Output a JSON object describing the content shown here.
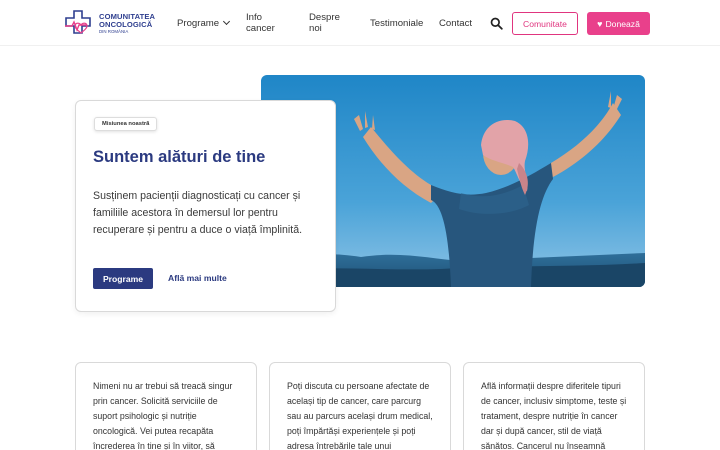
{
  "header": {
    "logo": {
      "line1": "COMUNITATEA",
      "line2": "ONCOLOGICĂ",
      "line3": "DIN ROMÂNIA"
    },
    "nav": [
      {
        "label": "Programe",
        "has_dropdown": true
      },
      {
        "label": "Info cancer"
      },
      {
        "label": "Despre noi"
      },
      {
        "label": "Testimoniale"
      },
      {
        "label": "Contact"
      }
    ],
    "search_icon": "search-icon",
    "community_button": "Comunitate",
    "donate_button": "Donează",
    "donate_icon": "heart-icon"
  },
  "hero": {
    "badge": "Misiunea noastră",
    "title": "Suntem alături de tine",
    "description": "Susținem pacienții diagnosticați cu cancer și familiile acestora în demersul lor pentru recuperare și pentru a duce o viață împlinită.",
    "primary_button": "Programe",
    "secondary_link": "Află mai multe"
  },
  "cards": [
    {
      "text": "Nimeni nu ar trebui să treacă singur prin cancer. Solicită serviciile de suport psihologic și nutriție oncologică. Vei putea recapăta încrederea în tine și în viitor, să"
    },
    {
      "text": "Poți discuta cu persoane afectate de același tip de cancer, care parcurg sau au parcurs același drum medical, poți împărtăși experiențele și poți adresa întrebările tale unui"
    },
    {
      "text": "Află informații despre diferitele tipuri de cancer, inclusiv simptome, teste și tratament, despre nutriție în cancer dar și după cancer, stil de viață sănătos. Cancerul nu înseamnă"
    }
  ],
  "colors": {
    "brand_blue": "#2b3a80",
    "brand_pink": "#e9408b",
    "sky": "#2a8fc9"
  }
}
